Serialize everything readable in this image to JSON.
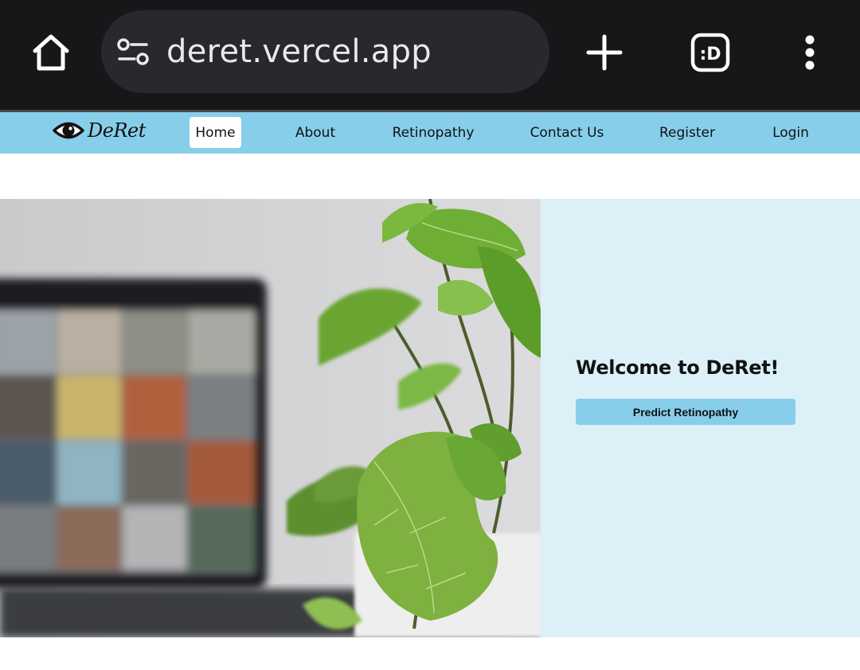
{
  "browser": {
    "url": "deret.vercel.app",
    "icons": {
      "home": "home-icon",
      "site_info": "tune-icon",
      "new_tab": "plus-icon",
      "extension": "extension-d-icon",
      "menu": "more-vert-icon"
    },
    "extension_label": ":D"
  },
  "navbar": {
    "brand": "DeRet",
    "brand_icon": "eye-icon",
    "links": [
      {
        "label": "Home",
        "active": true
      },
      {
        "label": "About",
        "active": false
      },
      {
        "label": "Retinopathy",
        "active": false
      },
      {
        "label": "Contact Us",
        "active": false
      },
      {
        "label": "Register",
        "active": false
      },
      {
        "label": "Login",
        "active": false
      }
    ]
  },
  "hero": {
    "title": "Welcome to DeRet!",
    "button_label": "Predict Retinopathy",
    "image": "photo of laptop showing video call grid beside a green potted plant"
  },
  "colors": {
    "navbar_bg": "#87ceeb",
    "panel_bg": "#dcf0f8",
    "button_bg": "#87ceeb",
    "chrome_bg": "#17171a",
    "url_pill_bg": "#28292d"
  }
}
